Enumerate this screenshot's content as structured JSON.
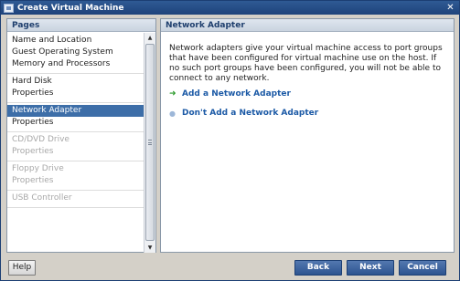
{
  "window": {
    "title": "Create Virtual Machine"
  },
  "left_panel": {
    "header": "Pages",
    "groups": [
      {
        "items": [
          {
            "label": "Name and Location",
            "state": "normal"
          },
          {
            "label": "Guest Operating System",
            "state": "normal"
          },
          {
            "label": "Memory and Processors",
            "state": "normal"
          }
        ]
      },
      {
        "items": [
          {
            "label": "Hard Disk",
            "state": "normal"
          },
          {
            "label": "Properties",
            "state": "normal"
          }
        ]
      },
      {
        "items": [
          {
            "label": "Network Adapter",
            "state": "active"
          },
          {
            "label": "Properties",
            "state": "normal"
          }
        ]
      },
      {
        "items": [
          {
            "label": "CD/DVD Drive",
            "state": "disabled"
          },
          {
            "label": "Properties",
            "state": "disabled"
          }
        ]
      },
      {
        "items": [
          {
            "label": "Floppy Drive",
            "state": "disabled"
          },
          {
            "label": "Properties",
            "state": "disabled"
          }
        ]
      },
      {
        "items": [
          {
            "label": "USB Controller",
            "state": "disabled"
          }
        ]
      }
    ]
  },
  "right_panel": {
    "header": "Network Adapter",
    "description": "Network adapters give your virtual machine access to port groups that have been configured for virtual machine use on the host. If no such port groups have been configured, you will not be able to connect to any network.",
    "options": {
      "add": "Add a Network Adapter",
      "dont_add": "Don't Add a Network Adapter"
    }
  },
  "buttons": {
    "help": "Help",
    "back": "Back",
    "next": "Next",
    "cancel": "Cancel"
  },
  "colors": {
    "accent": "#3d6ea8",
    "link": "#1c5aa6",
    "title_bar": "#2f5a94"
  },
  "icons": [
    "app-window-icon",
    "close-icon",
    "scroll-up-icon",
    "scroll-down-icon",
    "green-arrow-icon",
    "bullet-icon"
  ]
}
